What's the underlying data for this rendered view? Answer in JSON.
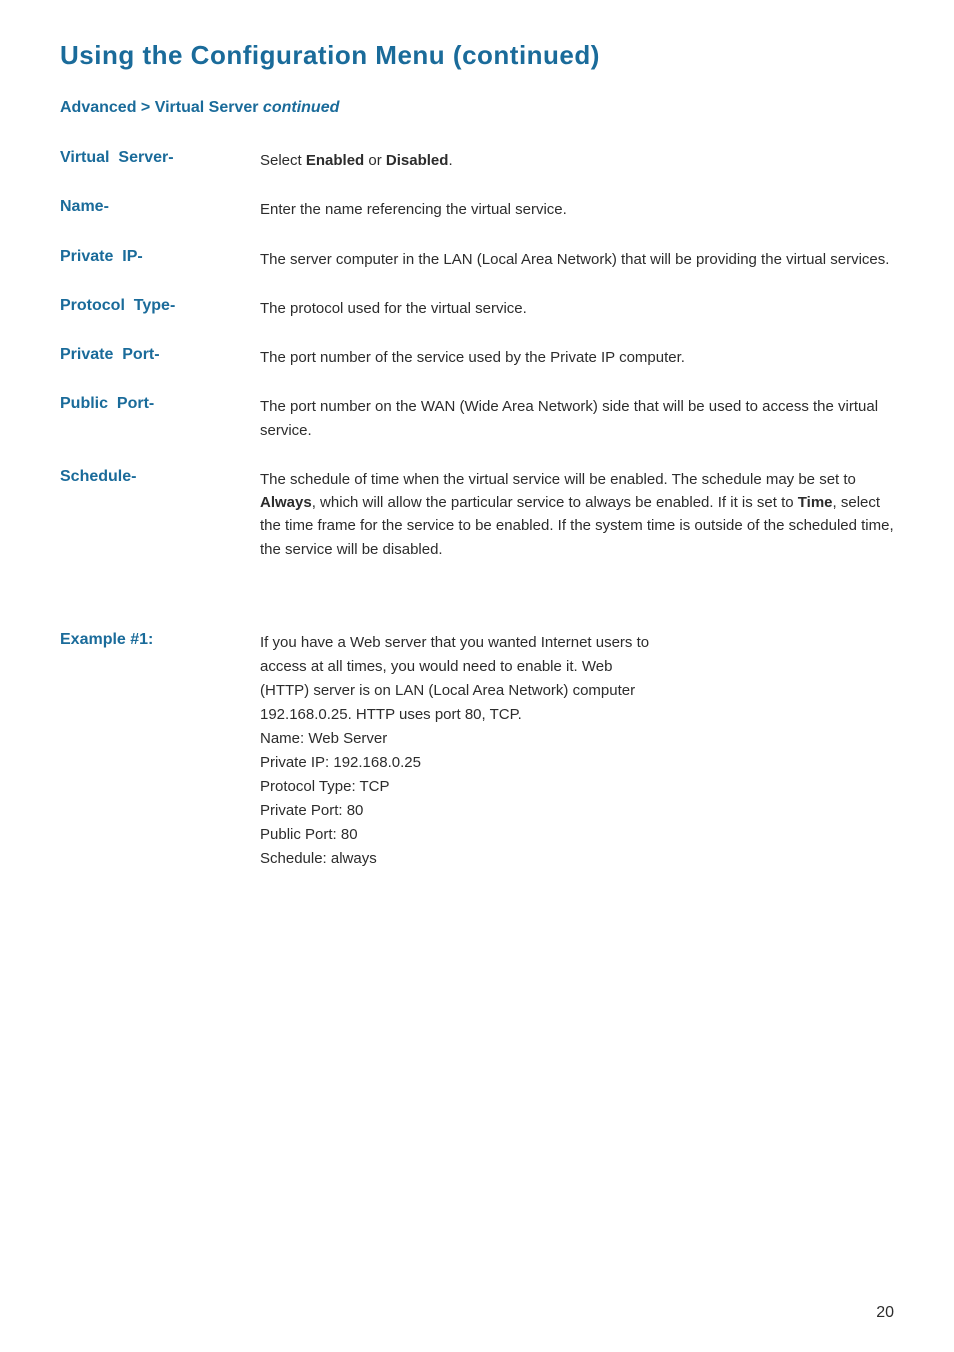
{
  "page": {
    "title": "Using  the  Configuration  Menu  (continued)",
    "number": "20"
  },
  "section": {
    "heading_prefix": "Advanced > Virtual Server ",
    "heading_continued": "continued"
  },
  "entries": [
    {
      "term": "Virtual  Server-",
      "description_parts": [
        {
          "text": "Select ",
          "bold": false
        },
        {
          "text": "Enabled",
          "bold": true
        },
        {
          "text": " or ",
          "bold": false
        },
        {
          "text": "Disabled",
          "bold": true
        },
        {
          "text": ".",
          "bold": false
        }
      ],
      "description_plain": "Select Enabled or Disabled."
    },
    {
      "term": "Name-",
      "description_plain": "Enter the name referencing the virtual service."
    },
    {
      "term": "Private  IP-",
      "description_plain": "The server computer in the LAN (Local Area Network) that will be providing the virtual services."
    },
    {
      "term": "Protocol  Type-",
      "description_plain": "The protocol used for the virtual service."
    },
    {
      "term": "Private  Port-",
      "description_plain": "The port number of the service used by the Private IP computer."
    },
    {
      "term": "Public  Port-",
      "description_plain": "The port number on the WAN (Wide Area Network) side that will be used to access the virtual service."
    },
    {
      "term": "Schedule-",
      "description_parts": [
        {
          "text": "The schedule of time when the virtual service will be enabled. The schedule may be set to ",
          "bold": false
        },
        {
          "text": "Always",
          "bold": true
        },
        {
          "text": ", which will allow the particular service to always be enabled. If it is set to ",
          "bold": false
        },
        {
          "text": "Time",
          "bold": true
        },
        {
          "text": ", select the time frame for the service to be enabled. If the system time is outside of the scheduled time, the service will be disabled.",
          "bold": false
        }
      ]
    }
  ],
  "example": {
    "term": "Example #1:",
    "lines": [
      "If you have a Web server that you wanted Internet users to",
      "access at all times, you would need to enable it. Web",
      "(HTTP) server is on LAN (Local Area Network) computer",
      "192.168.0.25. HTTP uses port 80, TCP.",
      "Name: Web Server",
      "Private IP: 192.168.0.25",
      "Protocol Type: TCP",
      "Private Port: 80",
      "Public Port: 80",
      "Schedule: always"
    ]
  }
}
